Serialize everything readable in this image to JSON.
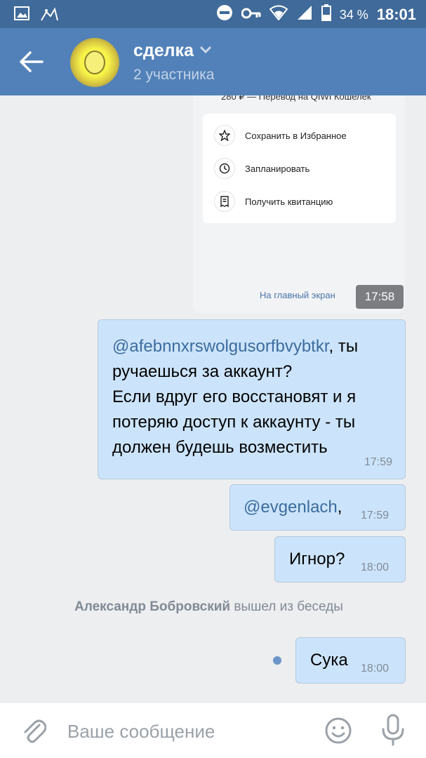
{
  "status_bar": {
    "battery": "34 %",
    "time": "18:01",
    "icons": [
      "image-icon",
      "android-bug-icon",
      "do-not-disturb-icon",
      "key-icon",
      "wifi-icon",
      "signal-icon",
      "battery-icon"
    ]
  },
  "header": {
    "title": "сделка",
    "subtitle": "2 участника",
    "icons": [
      "back-arrow-icon",
      "chevron-down-icon"
    ]
  },
  "screenshot_message": {
    "top_text": "280 ₽ — Перевод на QIWI Кошелек",
    "actions": [
      {
        "label": "Сохранить в Избранное",
        "icon": "star-icon"
      },
      {
        "label": "Запланировать",
        "icon": "clock-icon"
      },
      {
        "label": "Получить квитанцию",
        "icon": "receipt-icon"
      }
    ],
    "link": "На главный экран",
    "time": "17:58"
  },
  "messages": [
    {
      "mention": "@afebnnxrswolgusorfbvybtkr",
      "text": ", ты ручаешься за аккаунт?\nЕсли вдруг его восстановят и я потеряю доступ к аккаунту - ты должен будешь возместить",
      "time": "17:59"
    },
    {
      "mention": "@evgenlach",
      "text": ",",
      "time": "17:59"
    },
    {
      "text": "Игнор?",
      "time": "18:00"
    },
    {
      "text": "Сука",
      "time": "18:00"
    }
  ],
  "system_message": {
    "name": "Александр Бобровский",
    "text": " вышел из беседы"
  },
  "composer": {
    "placeholder": "Ваше сообщение",
    "icons": [
      "paperclip-icon",
      "smile-icon",
      "microphone-icon"
    ]
  },
  "colors": {
    "status_bar": "#3f6a99",
    "header": "#5181b8",
    "bubble": "#cce4fb",
    "mention": "#3c6c9e",
    "background": "#edeef0"
  }
}
